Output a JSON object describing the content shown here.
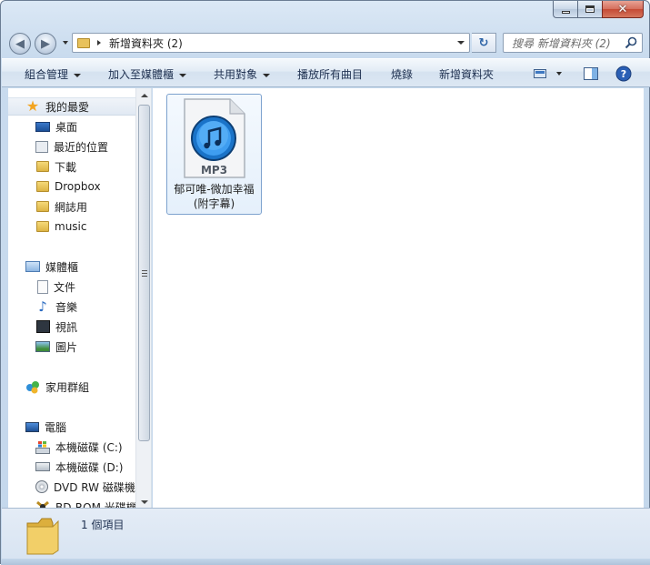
{
  "window": {
    "caption_buttons": {
      "minimize": "minimize",
      "maximize": "maximize",
      "close": "✕"
    }
  },
  "address_bar": {
    "path": [
      "新增資料夾 (2)"
    ]
  },
  "search": {
    "placeholder": "搜尋 新增資料夾 (2)"
  },
  "toolbar": {
    "organize": "組合管理",
    "include_in_library": "加入至媒體櫃",
    "share_with": "共用對象",
    "play_all": "播放所有曲目",
    "burn": "燒錄",
    "new_folder": "新增資料夾",
    "view_icons": [
      "view-options-icon",
      "preview-pane-icon",
      "help-icon"
    ]
  },
  "sidebar": {
    "favorites": {
      "label": "我的最愛",
      "items": [
        {
          "label": "桌面",
          "icon": "desktop-icon"
        },
        {
          "label": "最近的位置",
          "icon": "recent-places-icon"
        },
        {
          "label": "下載",
          "icon": "folder-icon"
        },
        {
          "label": "Dropbox",
          "icon": "folder-icon"
        },
        {
          "label": "網誌用",
          "icon": "folder-icon"
        },
        {
          "label": "music",
          "icon": "folder-icon"
        }
      ]
    },
    "libraries": {
      "label": "媒體櫃",
      "items": [
        {
          "label": "文件",
          "icon": "documents-icon"
        },
        {
          "label": "音樂",
          "icon": "music-icon"
        },
        {
          "label": "視訊",
          "icon": "video-icon"
        },
        {
          "label": "圖片",
          "icon": "pictures-icon"
        }
      ]
    },
    "homegroup": {
      "label": "家用群組"
    },
    "computer": {
      "label": "電腦",
      "items": [
        {
          "label": "本機磁碟 (C:)",
          "icon": "windows-drive-icon"
        },
        {
          "label": "本機磁碟 (D:)",
          "icon": "drive-icon"
        },
        {
          "label": "DVD RW 磁碟機",
          "icon": "dvd-drive-icon"
        },
        {
          "label": "BD-ROM 光碟機",
          "icon": "bd-drive-icon"
        }
      ]
    }
  },
  "files": [
    {
      "name": "郁可唯-微加幸福(附字幕)",
      "type_label": "MP3",
      "icon": "itunes-mp3-icon"
    }
  ],
  "status": {
    "item_count": "1 個項目"
  },
  "colors": {
    "window_frame": "#c4d7ec",
    "selection_border": "#7da2ce",
    "selection_fill": "#e5f0fb",
    "star": "#f3a420"
  }
}
